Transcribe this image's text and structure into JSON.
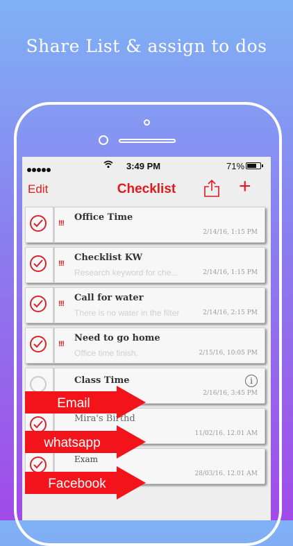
{
  "promo": {
    "headline": "Share List & assign to dos"
  },
  "status_bar": {
    "time": "3:49 PM",
    "battery": "71%"
  },
  "nav": {
    "edit": "Edit",
    "title": "Checklist",
    "add": "+"
  },
  "accent_color": "#e3181e",
  "items": [
    {
      "checked": true,
      "priority": "!!!",
      "title": "Office Time",
      "subtitle": "",
      "date": "2/14/16, 1:15 PM"
    },
    {
      "checked": true,
      "priority": "!!!",
      "title": "Checklist KW",
      "subtitle": "Research keyword for che...",
      "date": "2/14/16, 1:15 PM"
    },
    {
      "checked": true,
      "priority": "!!!",
      "title": "Call for water",
      "subtitle": "There is no water in the filter",
      "date": "2/14/16, 2:15 PM"
    },
    {
      "checked": true,
      "priority": "!!!",
      "title": "Need to go home",
      "subtitle": "Office time finish.",
      "date": "2/15/16, 10:05 PM"
    },
    {
      "checked": false,
      "priority": "",
      "title": "Class Time",
      "subtitle": "",
      "date": "2/16/16, 3:45 PM",
      "info": "i"
    },
    {
      "checked": true,
      "priority": "",
      "title": "Mira's Birthd",
      "subtitle": "",
      "date": "11/02/16. 12.01 AM"
    },
    {
      "checked": true,
      "priority": "",
      "title": "Exam",
      "subtitle": "",
      "date": "28/03/16. 12.01 AM"
    }
  ],
  "share_options": [
    "Email",
    "whatsapp",
    "Facebook"
  ]
}
